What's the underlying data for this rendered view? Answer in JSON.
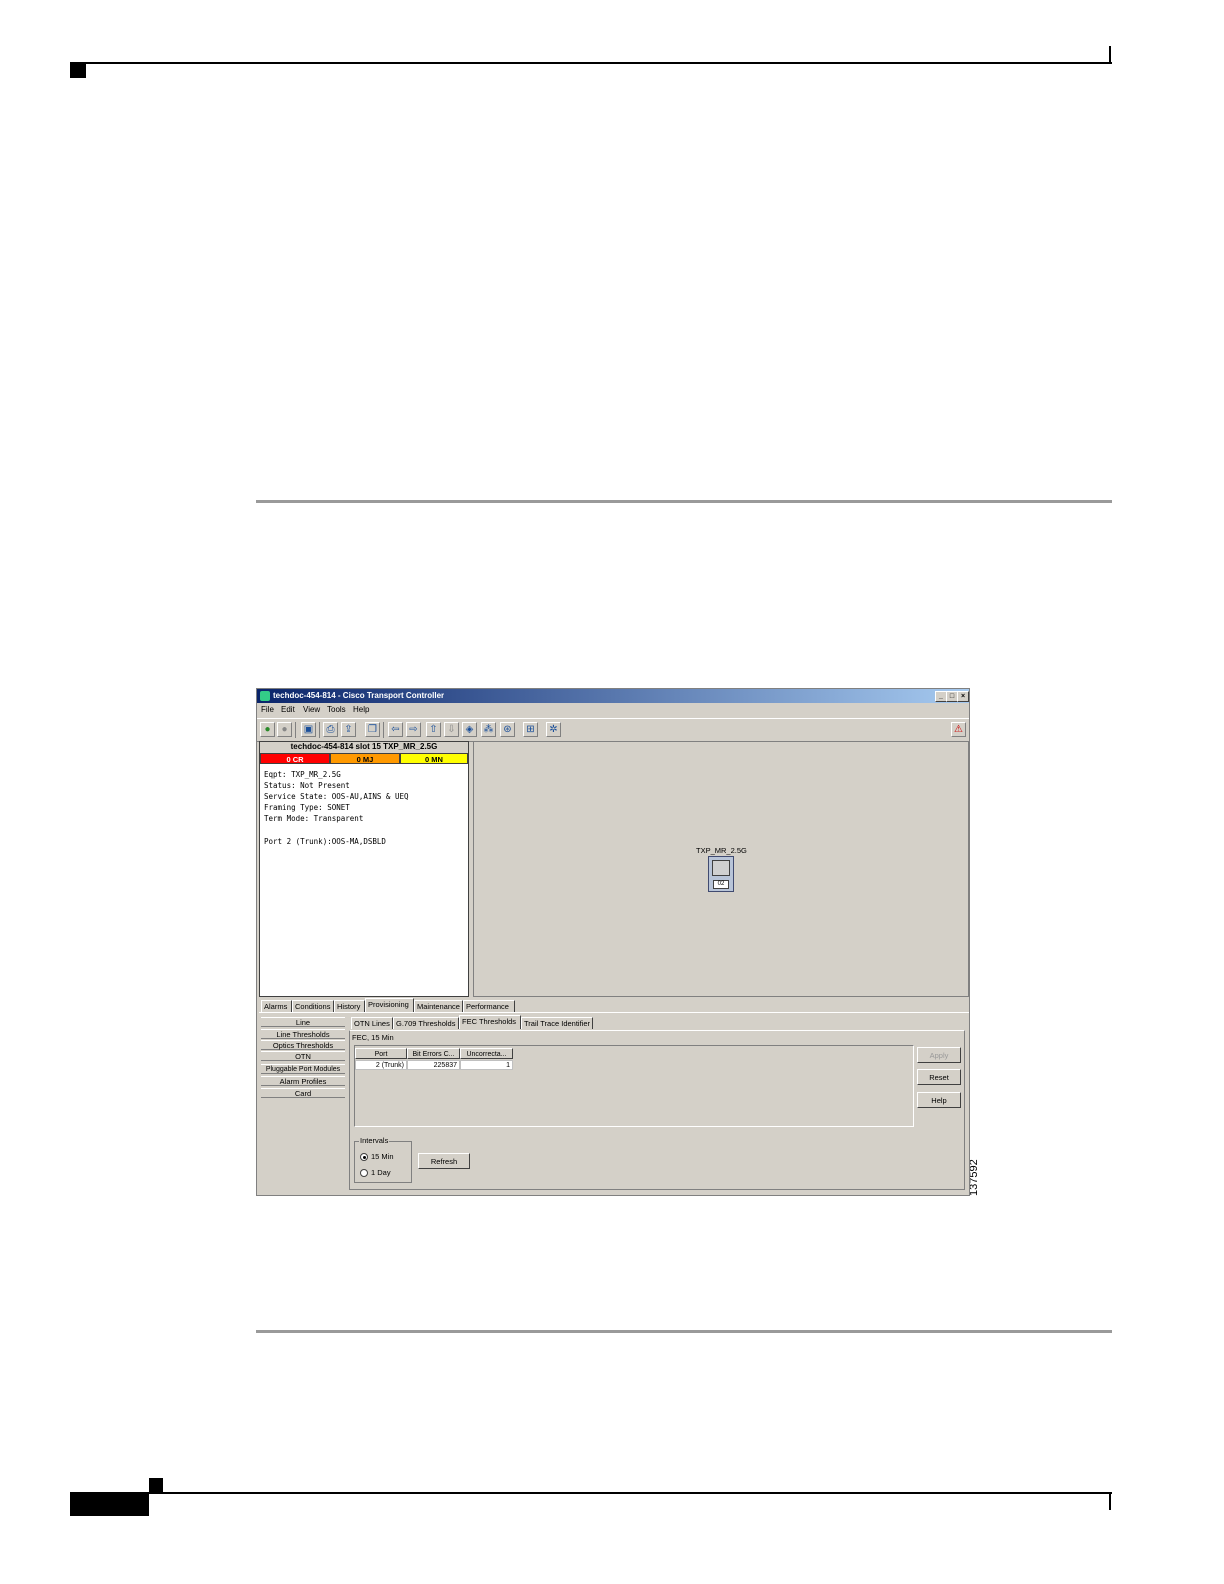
{
  "window": {
    "title": "techdoc-454-814 - Cisco Transport Controller",
    "controls": [
      "_",
      "□",
      "×"
    ]
  },
  "menu": [
    "File",
    "Edit",
    "View",
    "Tools",
    "Help"
  ],
  "toolbar_icons": [
    "network-view-icon",
    "stop-icon",
    "lock-icon",
    "print-icon",
    "export-icon",
    "copy-icon",
    "back-icon",
    "forward-icon",
    "up-icon",
    "down-icon",
    "shelf-icon",
    "nodes-icon",
    "circuit-icon",
    "preferences-icon",
    "help-icon",
    "delete-icon"
  ],
  "info_panel": {
    "node_title": "techdoc-454-814 slot 15 TXP_MR_2.5G",
    "alarms": {
      "cr": "0 CR",
      "mj": "0 MJ",
      "mn": "0 MN"
    },
    "lines": [
      "Eqpt: TXP_MR_2.5G",
      "Status: Not Present",
      "Service State: OOS-AU,AINS & UEQ",
      "Framing Type: SONET",
      "Term Mode: Transparent",
      "",
      "Port 2 (Trunk):OOS-MA,DSBLD"
    ]
  },
  "shelf": {
    "card_name": "TXP_MR_2.5G",
    "port_label": "02"
  },
  "main_tabs": [
    "Alarms",
    "Conditions",
    "History",
    "Provisioning",
    "Maintenance",
    "Performance"
  ],
  "active_main_tab": "Provisioning",
  "subnav": [
    "Line",
    "Line Thresholds",
    "Optics Thresholds",
    "OTN",
    "Pluggable Port Modules",
    "Alarm Profiles",
    "Card"
  ],
  "sub_tabs": [
    "OTN Lines",
    "G.709 Thresholds",
    "FEC Thresholds",
    "Trail Trace Identifier"
  ],
  "active_sub_tab": "FEC Thresholds",
  "fec": {
    "label": "FEC, 15 Min",
    "columns": [
      "Port",
      "Bit Errors C...",
      "Uncorrecta..."
    ],
    "rows": [
      [
        "2 (Trunk)",
        "225837",
        "1"
      ]
    ]
  },
  "buttons": {
    "apply": "Apply",
    "reset": "Reset",
    "help": "Help",
    "refresh": "Refresh"
  },
  "intervals": {
    "legend": "Intervals",
    "options": [
      "15 Min",
      "1 Day"
    ],
    "selected": "15 Min"
  },
  "figure_id": "137592"
}
